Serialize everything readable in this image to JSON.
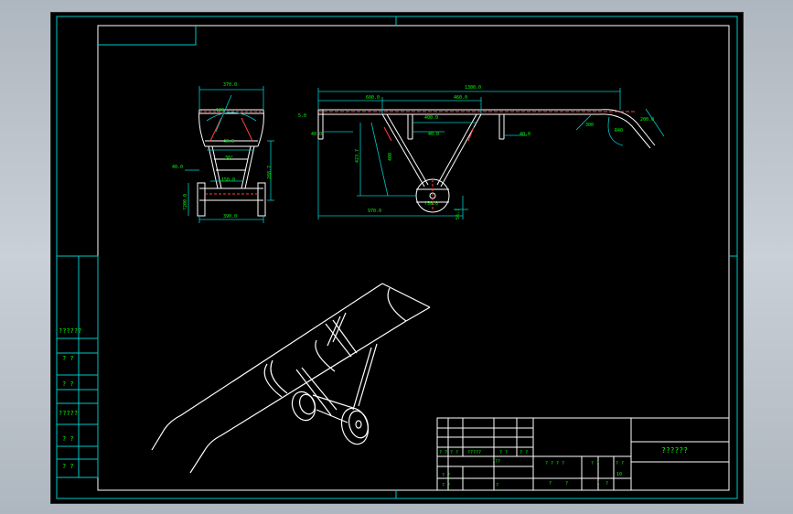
{
  "drawing": {
    "title_block_name": "??????",
    "left_strip": [
      "??????",
      "? ?",
      "? ?",
      "?????",
      "? ?",
      "? ?"
    ],
    "title_rows": {
      "r1": [
        "? ?",
        "? ?",
        "?????",
        "? ?",
        "? ?"
      ],
      "r2": [
        "? ?",
        "???",
        "? ? ? ?",
        "? ?",
        "? ?"
      ],
      "r3": [
        "? ?",
        "?",
        "?",
        "?",
        "?",
        "?"
      ],
      "scale": "10"
    },
    "dimensions": {
      "front_top": "370.0",
      "front_angle": "120",
      "front_width_mid": "40.0",
      "front_angle2": "30°",
      "front_height": "288.7",
      "front_axle": "40.0",
      "front_wheel_dia": "?200.0",
      "front_wheel_w": "150.0",
      "front_base": "390.0",
      "side_total": "1300.0",
      "side_left": "600.0",
      "side_mid": "460.0",
      "side_inner": "400.0",
      "side_small": "40.0",
      "side_small2": "40.0",
      "side_small3": "40.0",
      "side_left_h": "5.0",
      "side_height": "423.7",
      "side_incline": "400",
      "side_base": "970.0",
      "side_wheel": "?50.0",
      "side_wheel_h": "56.7",
      "side_end": "300",
      "side_r1": "R40",
      "side_r2": "200.0"
    }
  }
}
